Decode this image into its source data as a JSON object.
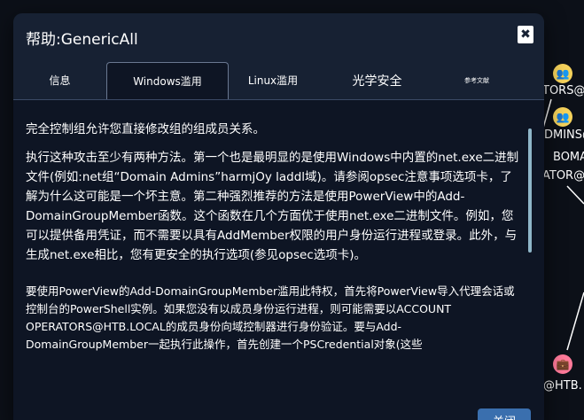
{
  "modal": {
    "title": "帮助:GenericAll",
    "close_label": "✖",
    "confirm_label": "关闭"
  },
  "tabs": [
    {
      "label": "信息"
    },
    {
      "label": "Windows滥用"
    },
    {
      "label": "Linux滥用"
    },
    {
      "label": "光学安全"
    },
    {
      "label": "参考文献"
    }
  ],
  "content": {
    "para1": "完全控制组允许您直接修改组的组成员关系。",
    "para2": "执行这种攻击至少有两种方法。第一个也是最明显的是使用Windows中内置的net.exe二进制文件(例如:net组“Domain Admins”harmjOy laddl域)。请参阅opsec注意事项选项卡，了解为什么这可能是一个坏主意。第二种强烈推荐的方法是使用PowerView中的Add-DomainGroupMember函数。这个函数在几个方面优于使用net.exe二进制文件。例如，您可以提供备用凭证，而不需要以具有AddMember权限的用户身份运行进程或登录。此外，与生成net.exe相比，您有更安全的执行选项(参见opsec选项卡)。",
    "para3": "要使用PowerView的Add-DomainGroupMember滥用此特权，首先将PowerView导入代理会话或控制台的PowerShell实例。如果您没有以成员身份运行进程，则可能需要以ACCOUNT OPERATORS@HTB.LOCAL的成员身份向域控制器进行身份验证。要与Add-DomainGroupMember一起执行此操作，首先创建一个PSCredential对象(这些"
  },
  "graph": {
    "labels": [
      "TORS@",
      "DMINS@",
      "BOMA",
      "ATOR@",
      "@HTB."
    ],
    "group_icon": "users-icon",
    "domain_icon": "briefcase-icon",
    "colors": {
      "group_node": "#f5d25b",
      "domain_node": "#ff7a9a",
      "edge": "#ffffff"
    }
  }
}
